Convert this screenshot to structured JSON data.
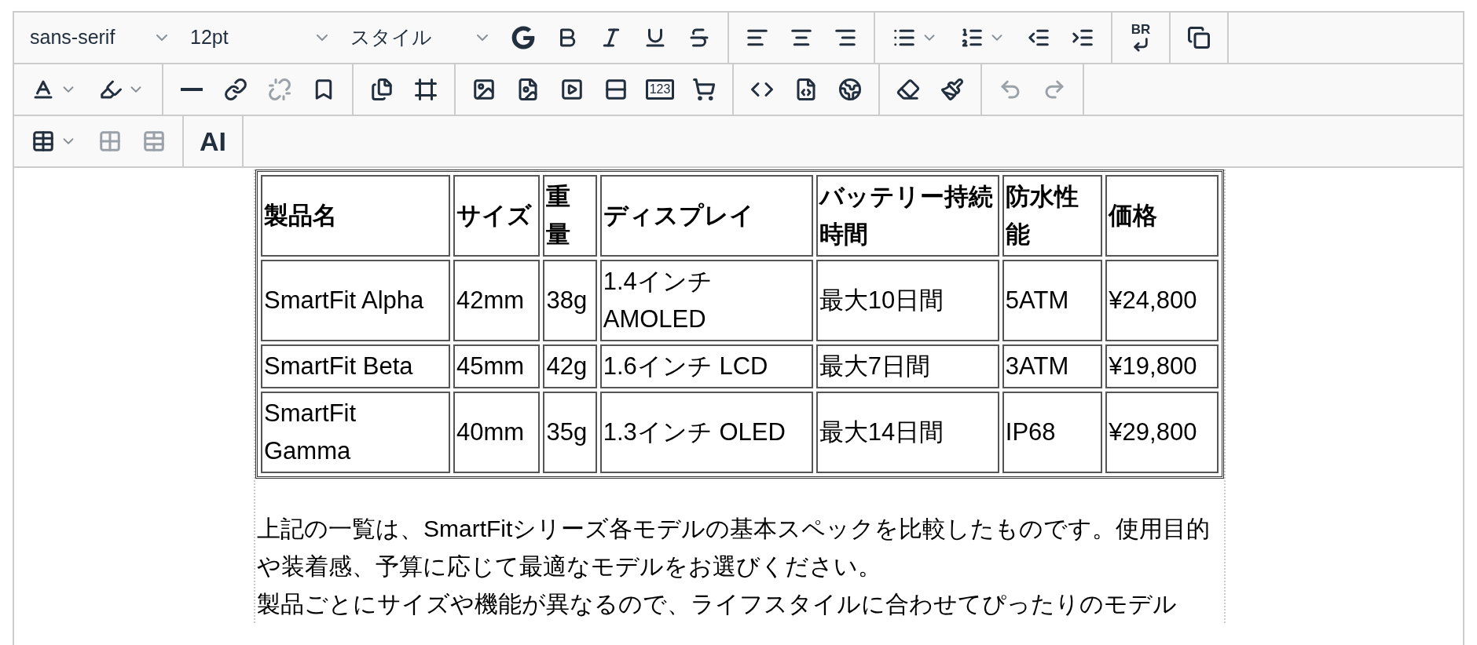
{
  "toolbar": {
    "rows": [
      {
        "groups": [
          {
            "items": [
              {
                "kind": "select",
                "label": "sans-serif",
                "disabled": false
              },
              {
                "kind": "select",
                "label": "12pt",
                "disabled": false
              },
              {
                "kind": "select",
                "label": "スタイル",
                "disabled": false
              },
              {
                "kind": "icon",
                "disabled": false
              },
              {
                "kind": "icon",
                "disabled": false
              },
              {
                "kind": "icon",
                "disabled": false
              },
              {
                "kind": "icon",
                "disabled": false
              },
              {
                "kind": "icon",
                "disabled": false
              }
            ]
          },
          {
            "items": [
              {
                "kind": "icon",
                "disabled": false
              },
              {
                "kind": "icon",
                "disabled": false
              },
              {
                "kind": "icon",
                "disabled": false
              }
            ]
          },
          {
            "items": [
              {
                "kind": "icon",
                "dropdown": true,
                "disabled": false
              },
              {
                "kind": "icon",
                "dropdown": true,
                "disabled": false
              },
              {
                "kind": "icon",
                "disabled": false
              },
              {
                "kind": "icon",
                "disabled": false
              }
            ]
          },
          {
            "items": [
              {
                "kind": "icon",
                "label": "BR",
                "disabled": false
              }
            ]
          },
          {
            "items": [
              {
                "kind": "icon",
                "disabled": false
              }
            ]
          }
        ]
      },
      {
        "groups": [
          {
            "items": [
              {
                "kind": "icon",
                "dropdown": true,
                "disabled": false
              },
              {
                "kind": "icon",
                "dropdown": true,
                "disabled": false
              }
            ]
          },
          {
            "items": [
              {
                "kind": "icon",
                "disabled": false
              },
              {
                "kind": "icon",
                "disabled": false
              },
              {
                "kind": "icon",
                "disabled": true
              },
              {
                "kind": "icon",
                "disabled": false
              }
            ]
          },
          {
            "items": [
              {
                "kind": "icon",
                "disabled": false
              },
              {
                "kind": "icon",
                "disabled": false
              }
            ]
          },
          {
            "items": [
              {
                "kind": "icon",
                "disabled": false
              },
              {
                "kind": "icon",
                "disabled": false
              },
              {
                "kind": "icon",
                "disabled": false
              },
              {
                "kind": "icon",
                "disabled": false
              },
              {
                "kind": "boxed-text",
                "label": "123",
                "disabled": false
              },
              {
                "kind": "icon",
                "disabled": false
              }
            ]
          },
          {
            "items": [
              {
                "kind": "icon",
                "disabled": false
              },
              {
                "kind": "icon",
                "disabled": false
              },
              {
                "kind": "icon",
                "disabled": false
              }
            ]
          },
          {
            "items": [
              {
                "kind": "icon",
                "disabled": false
              },
              {
                "kind": "icon",
                "disabled": false
              }
            ]
          },
          {
            "items": [
              {
                "kind": "icon",
                "disabled": true
              },
              {
                "kind": "icon",
                "disabled": true
              }
            ]
          }
        ]
      },
      {
        "groups": [
          {
            "items": [
              {
                "kind": "icon",
                "dropdown": true,
                "disabled": false
              },
              {
                "kind": "icon",
                "disabled": true
              },
              {
                "kind": "icon",
                "disabled": true
              }
            ]
          },
          {
            "items": [
              {
                "kind": "text",
                "label": "AI",
                "disabled": false
              }
            ]
          }
        ]
      }
    ]
  },
  "table": {
    "columns": [
      "製品名",
      "サイズ",
      "重量",
      "ディスプレイ",
      "バッテリー持続時間",
      "防水性能",
      "価格"
    ],
    "rows": [
      [
        "SmartFit Alpha",
        "42mm",
        "38g",
        "1.4インチ AMOLED",
        "最大10日間",
        "5ATM",
        "¥24,800"
      ],
      [
        "SmartFit Beta",
        "45mm",
        "42g",
        "1.6インチ LCD",
        "最大7日間",
        "3ATM",
        "¥19,800"
      ],
      [
        "SmartFit Gamma",
        "40mm",
        "35g",
        "1.3インチ OLED",
        "最大14日間",
        "IP68",
        "¥29,800"
      ]
    ]
  },
  "paragraphs": [
    "上記の一覧は、SmartFitシリーズ各モデルの基本スペックを比較したものです。使用目的や装着感、予算に応じて最適なモデルをお選びください。",
    "製品ごとにサイズや機能が異なるので、ライフスタイルに合わせてぴったりのモデル"
  ]
}
